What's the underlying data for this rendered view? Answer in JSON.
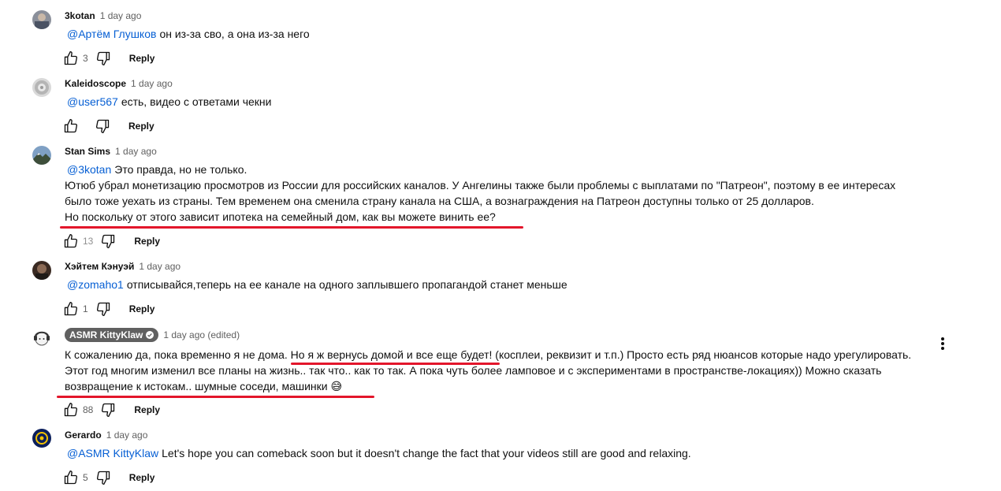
{
  "comments": [
    {
      "author": "3kotan",
      "time": "1 day ago",
      "mention": "@Артём Глушков",
      "text": "он из-за сво, а она из-за него",
      "likes": "3",
      "reply": "Reply"
    },
    {
      "author": "Kaleidoscope",
      "time": "1 day ago",
      "mention": "@user567",
      "text": "есть, видео с ответами чекни",
      "likes": "",
      "reply": "Reply"
    },
    {
      "author": "Stan Sims",
      "time": "1 day ago",
      "mention": "@3kotan",
      "text_first": "Это правда, но не только.",
      "lines": [
        "Ютюб убрал монетизацию просмотров из России для российских каналов. У Ангелины также были проблемы с выплатами по \"Патреон\", поэтому в ее интересах",
        "было тоже уехать из страны. Тем временем она сменила страну канала на США, а вознаграждения на Патреон доступны только от 25 долларов.",
        "Но поскольку от этого зависит ипотека на семейный дом, как вы можете винить ее?"
      ],
      "likes": "13",
      "reply": "Reply"
    },
    {
      "author": "Хэйтем Кэнуэй",
      "time": "1 day ago",
      "mention": "@zomaho1",
      "text": "отписывайся,теперь на ее канале на одного заплывшего пропагандой станет меньше",
      "likes": "1",
      "reply": "Reply"
    },
    {
      "author": "ASMR KittyKlaw",
      "time": "1 day ago (edited)",
      "lines": [
        "К сожалению да, пока временно я не дома. Но я ж вернусь домой и все еще будет! (косплеи, реквизит и т.п.) Просто есть ряд нюансов которые надо урегулировать.",
        "Этот год многим изменил все планы на жизнь.. так что.. как то так.  А пока чуть более ламповое и с экспериментами в пространстве-локациях)) Можно сказать",
        "возвращение  к истокам.. шумные соседи, машинки 😅"
      ],
      "likes": "88",
      "reply": "Reply"
    },
    {
      "author": "Gerardo",
      "time": "1 day ago",
      "mention": "@ASMR KittyKlaw",
      "text": "Let's hope you can comeback soon but it doesn't change the fact that your videos still are good and relaxing.",
      "likes": "5",
      "reply": "Reply"
    }
  ],
  "colors": {
    "mention": "#065fd4",
    "underline": "#e3162b",
    "meta": "#606060",
    "badge": "#606060"
  },
  "icons": [
    "thumb-up-icon",
    "thumb-down-icon",
    "more-vert-icon",
    "verified-check-icon"
  ]
}
